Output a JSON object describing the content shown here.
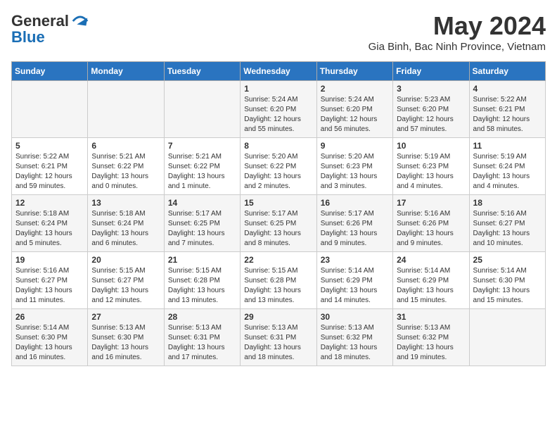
{
  "logo": {
    "general": "General",
    "blue": "Blue"
  },
  "header": {
    "month": "May 2024",
    "location": "Gia Binh, Bac Ninh Province, Vietnam"
  },
  "weekdays": [
    "Sunday",
    "Monday",
    "Tuesday",
    "Wednesday",
    "Thursday",
    "Friday",
    "Saturday"
  ],
  "weeks": [
    [
      {
        "day": "",
        "sunrise": "",
        "sunset": "",
        "daylight": ""
      },
      {
        "day": "",
        "sunrise": "",
        "sunset": "",
        "daylight": ""
      },
      {
        "day": "",
        "sunrise": "",
        "sunset": "",
        "daylight": ""
      },
      {
        "day": "1",
        "sunrise": "Sunrise: 5:24 AM",
        "sunset": "Sunset: 6:20 PM",
        "daylight": "Daylight: 12 hours and 55 minutes."
      },
      {
        "day": "2",
        "sunrise": "Sunrise: 5:24 AM",
        "sunset": "Sunset: 6:20 PM",
        "daylight": "Daylight: 12 hours and 56 minutes."
      },
      {
        "day": "3",
        "sunrise": "Sunrise: 5:23 AM",
        "sunset": "Sunset: 6:20 PM",
        "daylight": "Daylight: 12 hours and 57 minutes."
      },
      {
        "day": "4",
        "sunrise": "Sunrise: 5:22 AM",
        "sunset": "Sunset: 6:21 PM",
        "daylight": "Daylight: 12 hours and 58 minutes."
      }
    ],
    [
      {
        "day": "5",
        "sunrise": "Sunrise: 5:22 AM",
        "sunset": "Sunset: 6:21 PM",
        "daylight": "Daylight: 12 hours and 59 minutes."
      },
      {
        "day": "6",
        "sunrise": "Sunrise: 5:21 AM",
        "sunset": "Sunset: 6:22 PM",
        "daylight": "Daylight: 13 hours and 0 minutes."
      },
      {
        "day": "7",
        "sunrise": "Sunrise: 5:21 AM",
        "sunset": "Sunset: 6:22 PM",
        "daylight": "Daylight: 13 hours and 1 minute."
      },
      {
        "day": "8",
        "sunrise": "Sunrise: 5:20 AM",
        "sunset": "Sunset: 6:22 PM",
        "daylight": "Daylight: 13 hours and 2 minutes."
      },
      {
        "day": "9",
        "sunrise": "Sunrise: 5:20 AM",
        "sunset": "Sunset: 6:23 PM",
        "daylight": "Daylight: 13 hours and 3 minutes."
      },
      {
        "day": "10",
        "sunrise": "Sunrise: 5:19 AM",
        "sunset": "Sunset: 6:23 PM",
        "daylight": "Daylight: 13 hours and 4 minutes."
      },
      {
        "day": "11",
        "sunrise": "Sunrise: 5:19 AM",
        "sunset": "Sunset: 6:24 PM",
        "daylight": "Daylight: 13 hours and 4 minutes."
      }
    ],
    [
      {
        "day": "12",
        "sunrise": "Sunrise: 5:18 AM",
        "sunset": "Sunset: 6:24 PM",
        "daylight": "Daylight: 13 hours and 5 minutes."
      },
      {
        "day": "13",
        "sunrise": "Sunrise: 5:18 AM",
        "sunset": "Sunset: 6:24 PM",
        "daylight": "Daylight: 13 hours and 6 minutes."
      },
      {
        "day": "14",
        "sunrise": "Sunrise: 5:17 AM",
        "sunset": "Sunset: 6:25 PM",
        "daylight": "Daylight: 13 hours and 7 minutes."
      },
      {
        "day": "15",
        "sunrise": "Sunrise: 5:17 AM",
        "sunset": "Sunset: 6:25 PM",
        "daylight": "Daylight: 13 hours and 8 minutes."
      },
      {
        "day": "16",
        "sunrise": "Sunrise: 5:17 AM",
        "sunset": "Sunset: 6:26 PM",
        "daylight": "Daylight: 13 hours and 9 minutes."
      },
      {
        "day": "17",
        "sunrise": "Sunrise: 5:16 AM",
        "sunset": "Sunset: 6:26 PM",
        "daylight": "Daylight: 13 hours and 9 minutes."
      },
      {
        "day": "18",
        "sunrise": "Sunrise: 5:16 AM",
        "sunset": "Sunset: 6:27 PM",
        "daylight": "Daylight: 13 hours and 10 minutes."
      }
    ],
    [
      {
        "day": "19",
        "sunrise": "Sunrise: 5:16 AM",
        "sunset": "Sunset: 6:27 PM",
        "daylight": "Daylight: 13 hours and 11 minutes."
      },
      {
        "day": "20",
        "sunrise": "Sunrise: 5:15 AM",
        "sunset": "Sunset: 6:27 PM",
        "daylight": "Daylight: 13 hours and 12 minutes."
      },
      {
        "day": "21",
        "sunrise": "Sunrise: 5:15 AM",
        "sunset": "Sunset: 6:28 PM",
        "daylight": "Daylight: 13 hours and 13 minutes."
      },
      {
        "day": "22",
        "sunrise": "Sunrise: 5:15 AM",
        "sunset": "Sunset: 6:28 PM",
        "daylight": "Daylight: 13 hours and 13 minutes."
      },
      {
        "day": "23",
        "sunrise": "Sunrise: 5:14 AM",
        "sunset": "Sunset: 6:29 PM",
        "daylight": "Daylight: 13 hours and 14 minutes."
      },
      {
        "day": "24",
        "sunrise": "Sunrise: 5:14 AM",
        "sunset": "Sunset: 6:29 PM",
        "daylight": "Daylight: 13 hours and 15 minutes."
      },
      {
        "day": "25",
        "sunrise": "Sunrise: 5:14 AM",
        "sunset": "Sunset: 6:30 PM",
        "daylight": "Daylight: 13 hours and 15 minutes."
      }
    ],
    [
      {
        "day": "26",
        "sunrise": "Sunrise: 5:14 AM",
        "sunset": "Sunset: 6:30 PM",
        "daylight": "Daylight: 13 hours and 16 minutes."
      },
      {
        "day": "27",
        "sunrise": "Sunrise: 5:13 AM",
        "sunset": "Sunset: 6:30 PM",
        "daylight": "Daylight: 13 hours and 16 minutes."
      },
      {
        "day": "28",
        "sunrise": "Sunrise: 5:13 AM",
        "sunset": "Sunset: 6:31 PM",
        "daylight": "Daylight: 13 hours and 17 minutes."
      },
      {
        "day": "29",
        "sunrise": "Sunrise: 5:13 AM",
        "sunset": "Sunset: 6:31 PM",
        "daylight": "Daylight: 13 hours and 18 minutes."
      },
      {
        "day": "30",
        "sunrise": "Sunrise: 5:13 AM",
        "sunset": "Sunset: 6:32 PM",
        "daylight": "Daylight: 13 hours and 18 minutes."
      },
      {
        "day": "31",
        "sunrise": "Sunrise: 5:13 AM",
        "sunset": "Sunset: 6:32 PM",
        "daylight": "Daylight: 13 hours and 19 minutes."
      },
      {
        "day": "",
        "sunrise": "",
        "sunset": "",
        "daylight": ""
      }
    ]
  ]
}
